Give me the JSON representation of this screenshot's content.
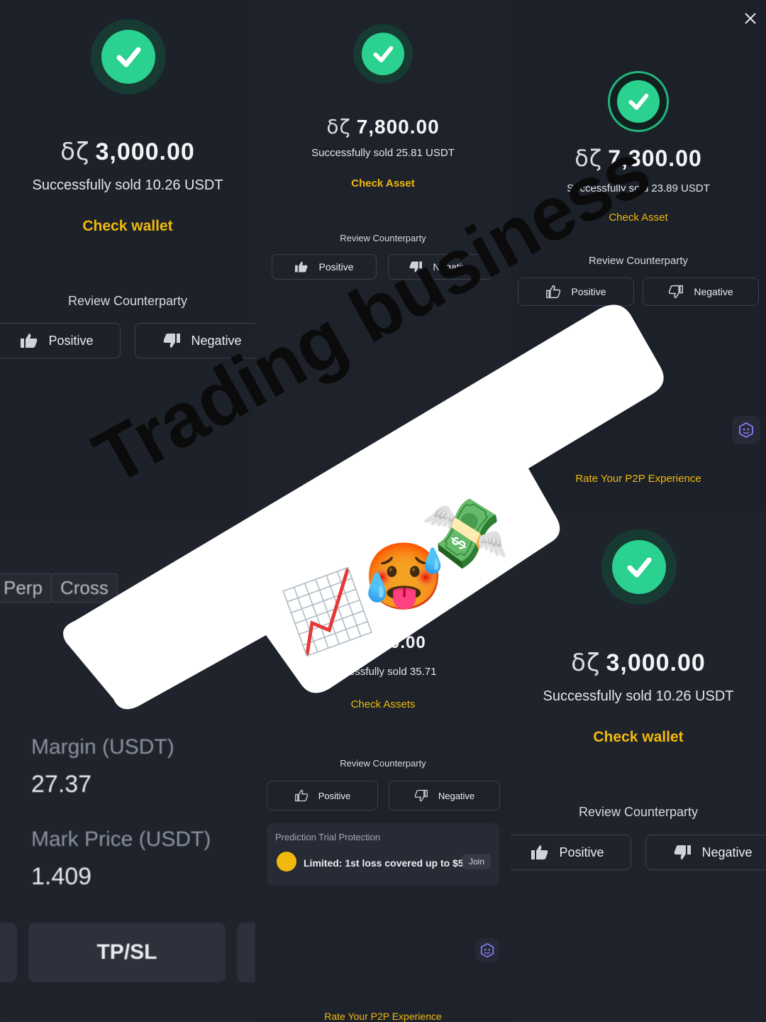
{
  "currency_symbol": "δζ",
  "panels": [
    {
      "amount": "3,000.00",
      "sold": "Successfully sold  10.26 USDT",
      "link": "Check wallet",
      "review": "Review Counterparty",
      "positive": "Positive",
      "negative": "Negative"
    },
    {
      "amount": "7,800.00",
      "sold": "Successfully sold 25.81 USDT",
      "link": "Check Asset",
      "review": "Review Counterparty",
      "positive": "Positive",
      "negative": "Negative"
    },
    {
      "amount": "7,300.00",
      "sold": "Successfully sold 23.89 USDT",
      "link": "Check Asset",
      "review": "Review Counterparty",
      "positive": "Positive",
      "negative": "Negative",
      "rate": "Rate Your P2P Experience"
    },
    {
      "chip1": "Perp",
      "chip2": "Cross",
      "margin_label": "Margin (USDT)",
      "margin_value": "27.37",
      "mark_label": "Mark Price (USDT)",
      "mark_value": "1.409",
      "tpsl": "TP/SL"
    },
    {
      "amount_fragment": "0.00",
      "sold_fragment": "essfully sold  35.71",
      "link": "Check Assets",
      "review": "Review Counterparty",
      "positive": "Positive",
      "negative": "Negative",
      "protection_title": "Prediction Trial Protection",
      "protection_text": "Limited: 1st loss covered up to $5",
      "join": "Join",
      "rate": "Rate Your P2P Experience"
    },
    {
      "amount": "3,000.00",
      "sold": "Successfully sold  10.26 USDT",
      "link": "Check wallet",
      "review": "Review Counterparty",
      "positive": "Positive",
      "negative": "Negative"
    }
  ],
  "sticker": {
    "text": "Trading business",
    "emoji": [
      "📈",
      "🥵",
      "💸"
    ]
  },
  "colors": {
    "accent": "#f0b90b",
    "success": "#2bd18f",
    "background": "#1b1f28"
  }
}
